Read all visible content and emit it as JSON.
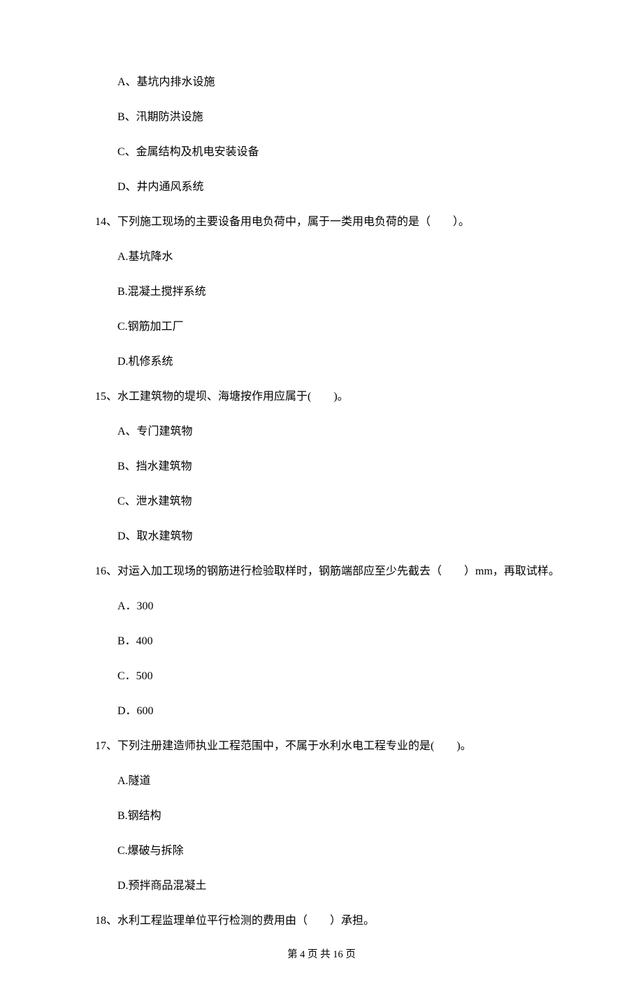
{
  "q13": {
    "options": {
      "a": "A、基坑内排水设施",
      "b": "B、汛期防洪设施",
      "c": "C、金属结构及机电安装设备",
      "d": "D、井内通风系统"
    }
  },
  "q14": {
    "text": "14、下列施工现场的主要设备用电负荷中，属于一类用电负荷的是（　　）。",
    "options": {
      "a": "A.基坑降水",
      "b": "B.混凝土搅拌系统",
      "c": "C.钢筋加工厂",
      "d": "D.机修系统"
    }
  },
  "q15": {
    "text": "15、水工建筑物的堤坝、海塘按作用应属于(　　)。",
    "options": {
      "a": "A、专门建筑物",
      "b": "B、挡水建筑物",
      "c": "C、泄水建筑物",
      "d": "D、取水建筑物"
    }
  },
  "q16": {
    "text": "16、对运入加工现场的钢筋进行检验取样时，钢筋端部应至少先截去（　　）mm，再取试样。",
    "options": {
      "a": "A．300",
      "b": "B．400",
      "c": "C．500",
      "d": "D．600"
    }
  },
  "q17": {
    "text": "17、下列注册建造师执业工程范围中，不属于水利水电工程专业的是(　　)。",
    "options": {
      "a": "A.隧道",
      "b": "B.钢结构",
      "c": "C.爆破与拆除",
      "d": "D.预拌商品混凝土"
    }
  },
  "q18": {
    "text": "18、水利工程监理单位平行检测的费用由（　　）承担。"
  },
  "footer": "第 4 页 共 16 页"
}
